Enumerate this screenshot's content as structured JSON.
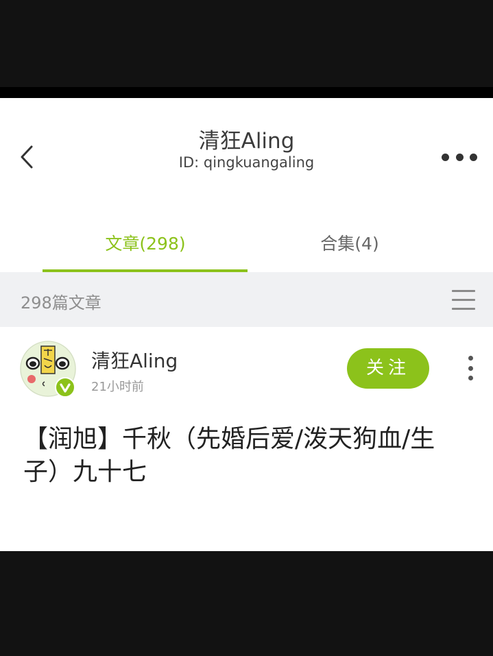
{
  "header": {
    "title": "清狂Aling",
    "subtitle": "ID: qingkuangaling",
    "back_icon": "chevron-left-icon",
    "more_icon": "more-horizontal-icon"
  },
  "tabs": [
    {
      "label": "文章(298)",
      "active": true
    },
    {
      "label": "合集(4)",
      "active": false
    }
  ],
  "filter": {
    "count_label": "298篇文章",
    "menu_icon": "menu-icon"
  },
  "post": {
    "author": "清狂Aling",
    "time": "21小时前",
    "follow_label": "关注",
    "title": "【润旭】千秋（先婚后爱/泼天狗血/生子）九十七"
  },
  "colors": {
    "accent": "#8cc21b",
    "tab_inactive": "#666666",
    "filter_bg": "#f0f1f3",
    "frame": "#121212"
  }
}
